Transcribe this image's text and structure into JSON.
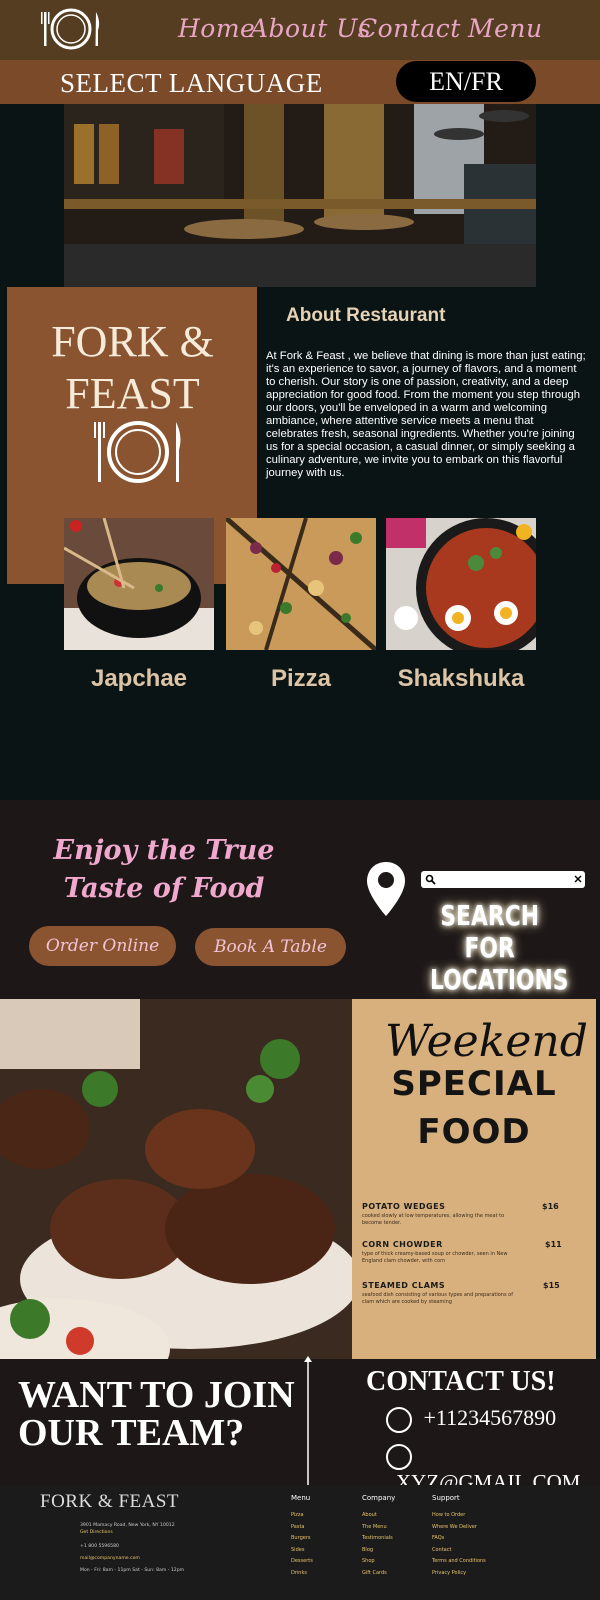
{
  "header": {
    "nav": [
      "Home",
      "About Us",
      "Contact",
      "Menu"
    ],
    "language_label": "SELECT LANGUAGE",
    "language_button": "EN/FR"
  },
  "brand": {
    "line1": "FORK &",
    "line2": "FEAST"
  },
  "about": {
    "title": "About Restaurant",
    "body": "At Fork & Feast , we believe that dining is more than just eating; it's an experience to savor, a journey of flavors, and a moment to cherish. Our story is one of passion, creativity, and a deep appreciation for good food. From the moment you step through our doors, you'll be enveloped in a warm and welcoming ambiance, where attentive service meets a menu that celebrates fresh, seasonal ingredients. Whether you're joining us for a special occasion, a casual dinner, or simply seeking a culinary adventure, we invite you to embark on this flavorful journey with us."
  },
  "dishes": [
    "Japchae",
    "Pizza",
    "Shakshuka"
  ],
  "taste": {
    "title": "Enjoy the True Taste of Food",
    "order_button": "Order Online",
    "book_button": "Book A Table",
    "search_label": "SEARCH FOR LOCATIONS"
  },
  "special": {
    "script": "Weekend",
    "line1": "SPECIAL",
    "line2": "FOOD",
    "items": [
      {
        "name": "POTATO WEDGES",
        "price": "$16",
        "desc": "cooked slowly at low temperatures, allowing the meat to become tender."
      },
      {
        "name": "CORN CHOWDER",
        "price": "$11",
        "desc": "type of thick creamy-based soup or chowder, seen in New England clam chowder, with corn"
      },
      {
        "name": "STEAMED CLAMS",
        "price": "$15",
        "desc": "seafood dish consisting of various types and preparations of clam which are cooked by steaming"
      }
    ]
  },
  "join": {
    "line1": "WANT TO JOIN",
    "line2": "OUR TEAM?"
  },
  "contact": {
    "title": "CONTACT US!",
    "phone": "+11234567890",
    "email": "XYZ@GMAIL.COM"
  },
  "footer": {
    "brand": "FORK & FEAST",
    "address": "3901 Mamacy Road, New York, NY 10012",
    "directions": "Get Directions",
    "phone": "+1 800 5596580",
    "email": "mail@companyname.com",
    "hours": "Mon - Fri: 8am - 11pm  Sat - Sun: 8am - 12pm",
    "columns": [
      {
        "title": "Menu",
        "links": [
          "Pizza",
          "Pasta",
          "Burgers",
          "Sides",
          "Desserts",
          "Drinks"
        ]
      },
      {
        "title": "Company",
        "links": [
          "About",
          "The Menu",
          "Testimonials",
          "Blog",
          "Shop",
          "Gift Cards"
        ]
      },
      {
        "title": "Support",
        "links": [
          "How to Order",
          "Where We Deliver",
          "FAQs",
          "Contact",
          "Terms and Conditions",
          "Privacy Policy"
        ]
      }
    ]
  },
  "colors": {
    "header": "#553d22",
    "accent_brown": "#8a5431",
    "nav_pink": "#e8a6c4",
    "dark_bg": "#0b1414",
    "menu_panel": "#d8b07d"
  }
}
